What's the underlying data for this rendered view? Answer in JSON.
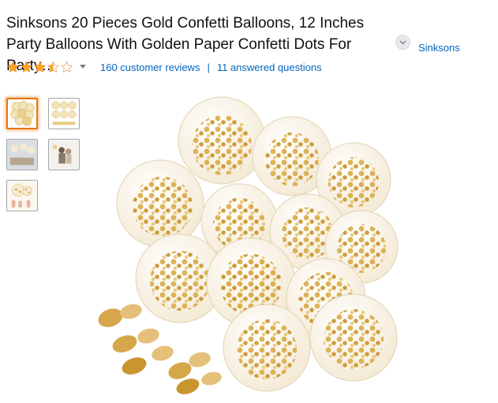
{
  "product": {
    "title": "Sinksons 20 Pieces Gold Confetti Balloons, 12 Inches Party Balloons With Golden Paper Confetti Dots For Party…",
    "brand": "Sinksons"
  },
  "rating": {
    "stars": 3.5,
    "max_stars": 5,
    "reviews_text": "160 customer reviews",
    "separator": "|",
    "questions_text": "11 answered questions"
  },
  "gallery": {
    "thumbnail_count": 5,
    "selected_index": 0
  },
  "colors": {
    "link": "#0066c0",
    "star": "#ffa41c",
    "selected_border": "#e77600",
    "gold": "#d4a73a"
  },
  "icons": {
    "expand": "chevron-down-icon",
    "rating_dropdown": "caret-down-icon"
  }
}
